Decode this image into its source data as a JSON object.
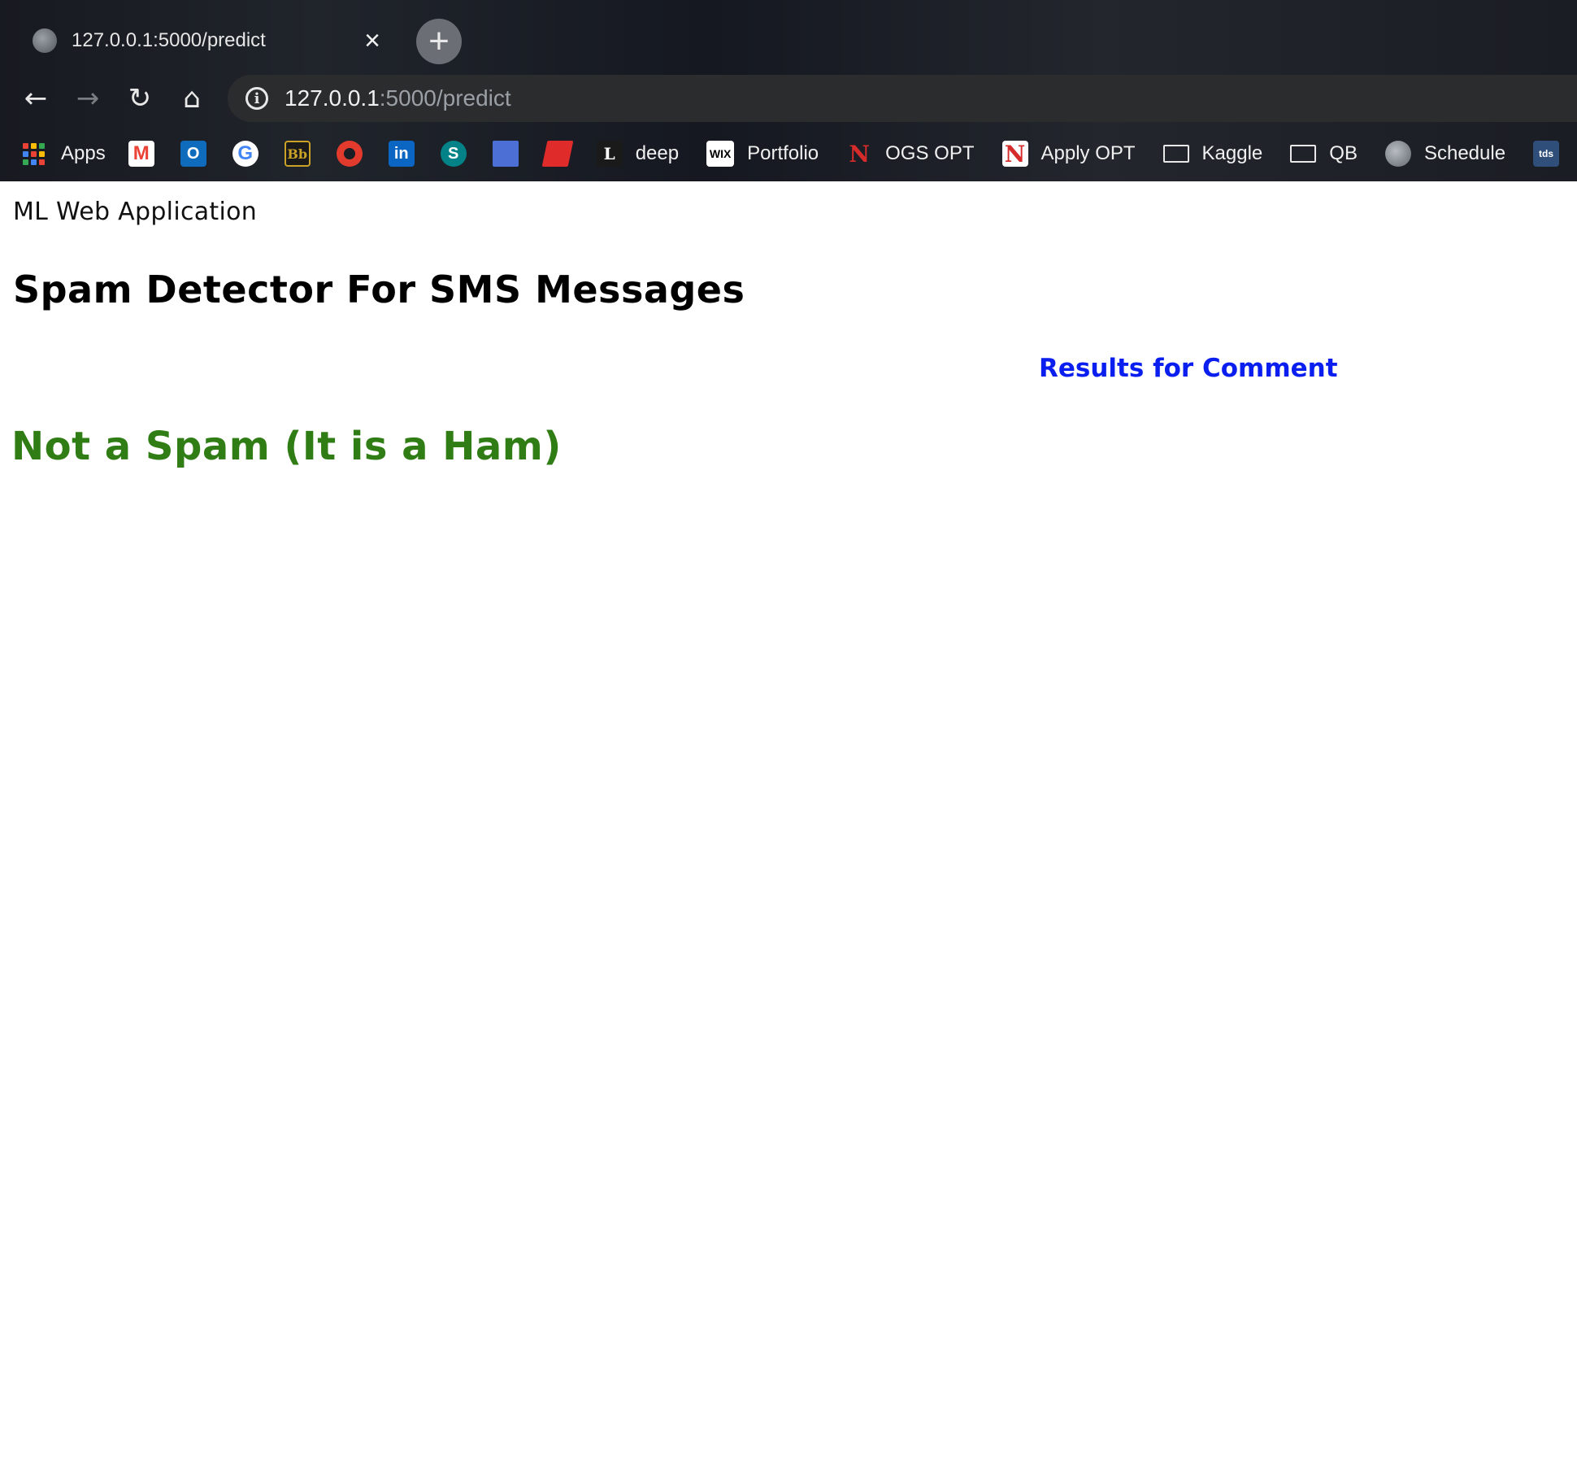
{
  "tab": {
    "title": "127.0.0.1:5000/predict",
    "close_glyph": "×",
    "new_tab_glyph": "+"
  },
  "nav": {
    "back_glyph": "←",
    "forward_glyph": "→",
    "reload_glyph": "↻",
    "home_glyph": "⌂"
  },
  "address": {
    "host": "127.0.0.1",
    "rest": ":5000/predict",
    "info_glyph": "i"
  },
  "bookmarks": {
    "apps": "Apps",
    "deep_icon": "L",
    "deep": "deep",
    "wix_icon": "WIX",
    "portfolio": "Portfolio",
    "ogs_icon": "N",
    "ogs_opt": "OGS OPT",
    "apply_icon": "N",
    "apply_opt": "Apply OPT",
    "kaggle": "Kaggle",
    "qb": "QB",
    "schedule": "Schedule",
    "tds_icon": "tds",
    "bb_icon": "Bb",
    "linkedin_icon": "in",
    "sharepoint_icon": "S",
    "gmail_icon": "M",
    "outlook_icon": "O",
    "google_icon": "G"
  },
  "page": {
    "brand": "ML Web Application",
    "title": "Spam Detector For SMS Messages",
    "results_heading": "Results for Comment",
    "prediction": "Not a Spam (It is a Ham)"
  },
  "colors": {
    "results_heading": "#0a1ef0",
    "prediction": "#2f7d14"
  }
}
